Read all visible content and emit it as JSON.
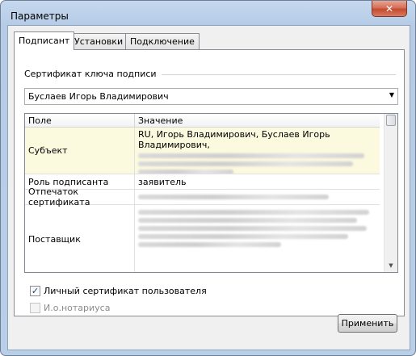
{
  "window": {
    "title": "Параметры",
    "close_glyph": "✕"
  },
  "tabs": [
    {
      "label": "Подписант",
      "active": true
    },
    {
      "label": "Установки",
      "active": false
    },
    {
      "label": "Подключение",
      "active": false
    }
  ],
  "signer": {
    "group_label": "Сертификат ключа подписи",
    "certificate_selected": "Буслаев Игорь Владимирович",
    "grid": {
      "headers": [
        "Поле",
        "Значение"
      ],
      "rows": [
        {
          "field": "Субъект",
          "value": "RU, Игорь Владимирович, Буслаев Игорь Владимирович,"
        },
        {
          "field": "Роль подписанта",
          "value": "заявитель"
        },
        {
          "field": "Отпечаток сертификата",
          "value": ""
        },
        {
          "field": "Поставщик",
          "value": ""
        }
      ]
    },
    "checkboxes": [
      {
        "label": "Личный сертификат пользователя",
        "checked": true,
        "enabled": true
      },
      {
        "label": "И.о.нотариуса",
        "checked": false,
        "enabled": false
      }
    ]
  },
  "buttons": {
    "apply": "Применить"
  },
  "icons": {
    "close": "close-icon",
    "combo_arrow": "chevron-down-icon",
    "scroll_up": "arrow-up-icon",
    "scroll_down": "arrow-down-icon",
    "check": "checkmark-icon"
  }
}
